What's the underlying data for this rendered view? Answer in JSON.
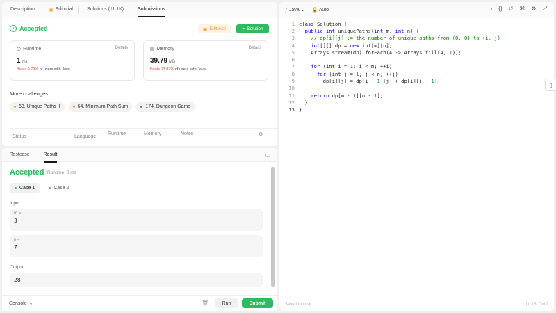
{
  "problem_tabs": [
    {
      "label": "Description"
    },
    {
      "label": "Editorial"
    },
    {
      "label": "Solutions (11.1K)"
    },
    {
      "label": "Submissions"
    }
  ],
  "submission": {
    "status": "Accepted",
    "editorial_btn": "Editorial",
    "solution_btn": "Solution",
    "runtime": {
      "label": "Runtime",
      "details": "Details",
      "value": "1",
      "unit": "ms",
      "beats_pct": "Beats 9.79%",
      "beats_text": "of users with Java"
    },
    "memory": {
      "label": "Memory",
      "details": "Details",
      "value": "39.79",
      "unit": "MB",
      "beats_pct": "Beats 13.87%",
      "beats_text": "of users with Java"
    }
  },
  "more_challenges": {
    "title": "More challenges",
    "items": [
      {
        "label": "63. Unique Paths II",
        "color": "#f0a020"
      },
      {
        "label": "64. Minimum Path Sum",
        "color": "#f0a020"
      },
      {
        "label": "174. Dungeon Game",
        "color": "#e0503c"
      }
    ]
  },
  "submission_table": {
    "headers": [
      "Status",
      "Language",
      "Runtime",
      "Memory",
      "Notes"
    ]
  },
  "result_tabs": [
    {
      "label": "Testcase"
    },
    {
      "label": "Result"
    }
  ],
  "result": {
    "status": "Accepted",
    "runtime": "Runtime: 0 ms",
    "cases": [
      "Case 1",
      "Case 2"
    ],
    "input_label": "Input",
    "inputs": [
      {
        "name": "m =",
        "value": "3"
      },
      {
        "name": "n =",
        "value": "7"
      }
    ],
    "output_label": "Output",
    "output": "28"
  },
  "bottom": {
    "console": "Console",
    "run": "Run",
    "submit": "Submit"
  },
  "editor": {
    "language": "Java",
    "auto": "Auto",
    "status": "Saved to local",
    "position": "Ln 13, Col 2",
    "lines": [
      "class Solution {",
      "  public int uniquePaths(int m, int n) {",
      "    // dp[i][j] := the number of unique paths from (0, 0) to (i, j)",
      "    int[][] dp = new int[m][n];",
      "    Arrays.stream(dp).forEach(A -> Arrays.fill(A, 1));",
      "",
      "    for (int i = 1; i < m; ++i)",
      "      for (int j = 1; j < n; ++j)",
      "        dp[i][j] = dp[i - 1][j] + dp[i][j - 1];",
      "",
      "    return dp[m - 1][n - 1];",
      "  }",
      "}"
    ]
  }
}
